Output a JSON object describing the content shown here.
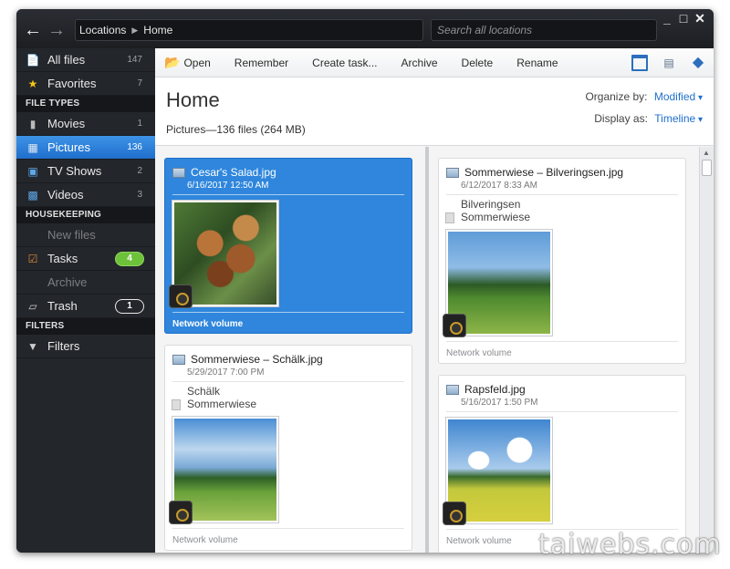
{
  "titlebar": {
    "breadcrumb": [
      "Locations",
      "Home"
    ],
    "search_placeholder": "Search all locations",
    "window_controls": [
      "_",
      "□",
      "✕"
    ]
  },
  "sidebar": {
    "items": [
      {
        "label": "All files",
        "count": "147",
        "icon": "file-icon"
      },
      {
        "label": "Favorites",
        "count": "7",
        "icon": "star-icon"
      }
    ],
    "file_types_header": "FILE TYPES",
    "file_types": [
      {
        "label": "Movies",
        "count": "1",
        "icon": "film-icon"
      },
      {
        "label": "Pictures",
        "count": "136",
        "icon": "picture-icon",
        "selected": true
      },
      {
        "label": "TV Shows",
        "count": "2",
        "icon": "tv-icon"
      },
      {
        "label": "Videos",
        "count": "3",
        "icon": "video-icon"
      }
    ],
    "housekeeping_header": "HOUSEKEEPING",
    "housekeeping": [
      {
        "label": "New files",
        "icon": "new-files-icon",
        "disabled": true
      },
      {
        "label": "Tasks",
        "badge": "4",
        "icon": "tasks-icon"
      },
      {
        "label": "Archive",
        "icon": "archive-icon",
        "disabled": true
      },
      {
        "label": "Trash",
        "badge": "1",
        "icon": "trash-icon"
      }
    ],
    "filters_header": "FILTERS",
    "filters": [
      {
        "label": "Filters",
        "icon": "funnel-icon"
      }
    ]
  },
  "toolbar": {
    "open": "Open",
    "remember": "Remember",
    "create_task": "Create task...",
    "archive": "Archive",
    "delete": "Delete",
    "rename": "Rename"
  },
  "header": {
    "title": "Home",
    "subtitle": "Pictures—136 files (264 MB)",
    "organize_label": "Organize by:",
    "organize_value": "Modified",
    "display_label": "Display as:",
    "display_value": "Timeline"
  },
  "cards": [
    {
      "name": "Cesar's Salad.jpg",
      "date": "6/16/2017 12:50 AM",
      "location": "Network volume",
      "selected": true
    },
    {
      "name": "Sommerwiese – Bilveringsen.jpg",
      "date": "6/12/2017 8:33 AM",
      "place1": "Bilveringsen",
      "place2": "Sommerwiese",
      "location": "Network volume"
    },
    {
      "name": "Sommerwiese – Schälk.jpg",
      "date": "5/29/2017 7:00 PM",
      "place1": "Schälk",
      "place2": "Sommerwiese",
      "location": "Network volume"
    },
    {
      "name": "Rapsfeld.jpg",
      "date": "5/16/2017 1:50 PM",
      "location": "Network volume"
    }
  ],
  "watermark": "taiwebs.com",
  "colors": {
    "selection": "#2f86dc",
    "accent": "#1f6fcc",
    "badge_green": "#6ec23a"
  }
}
